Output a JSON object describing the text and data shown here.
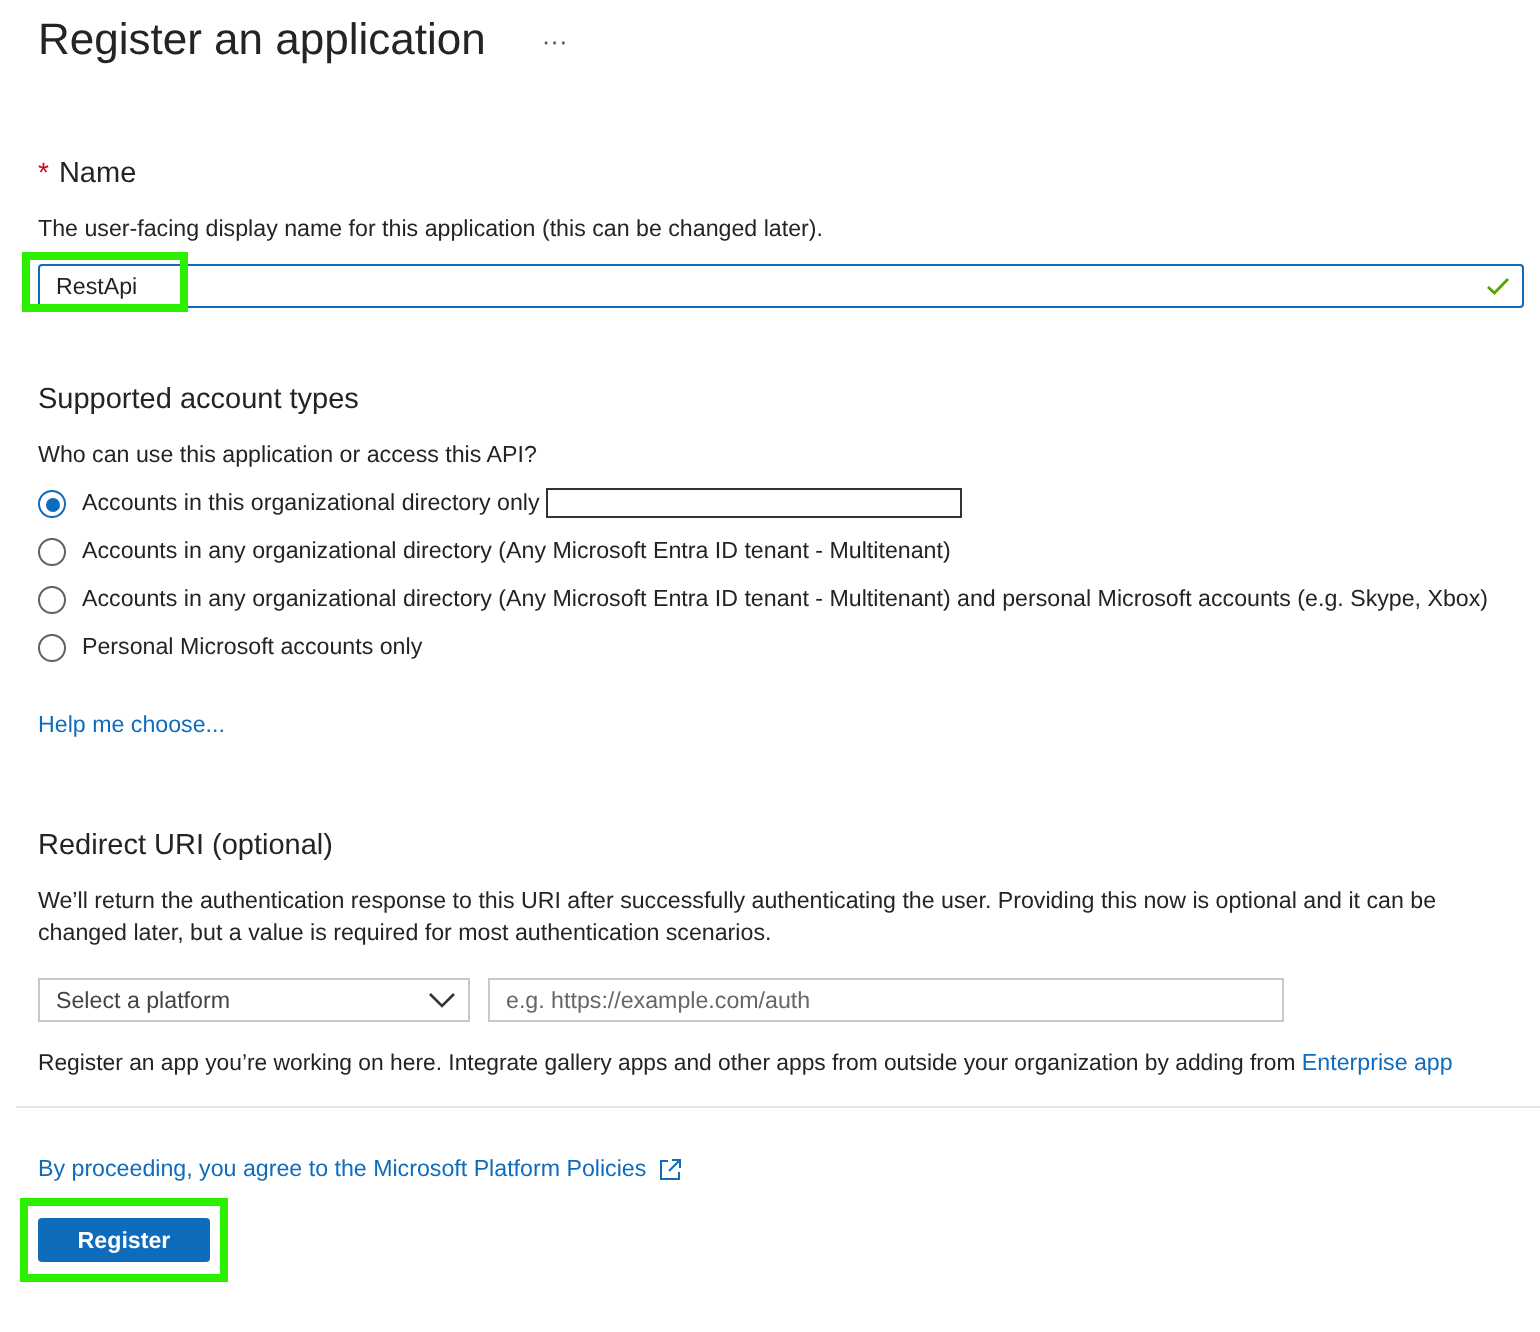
{
  "page": {
    "title": "Register an application",
    "more": "···"
  },
  "name_section": {
    "required_mark": "*",
    "label": "Name",
    "description": "The user-facing display name for this application (this can be changed later).",
    "field": {
      "value": "RestApi",
      "valid": true
    }
  },
  "account_types": {
    "heading": "Supported account types",
    "question": "Who can use this application or access this API?",
    "options": [
      {
        "label": "Accounts in this organizational directory only",
        "selected": true,
        "redacted": true
      },
      {
        "label": "Accounts in any organizational directory (Any Microsoft Entra ID tenant - Multitenant)",
        "selected": false,
        "redacted": false
      },
      {
        "label": "Accounts in any organizational directory (Any Microsoft Entra ID tenant - Multitenant) and personal Microsoft accounts (e.g. Skype, Xbox)",
        "selected": false,
        "redacted": false
      },
      {
        "label": "Personal Microsoft accounts only",
        "selected": false,
        "redacted": false
      }
    ]
  },
  "help_link": "Help me choose...",
  "redirect": {
    "heading": "Redirect URI (optional)",
    "description": "We’ll return the authentication response to this URI after successfully authenticating the user. Providing this now is optional and it can be changed later, but a value is required for most authentication scenarios.",
    "platform": {
      "placeholder": "Select a platform"
    },
    "uri": {
      "placeholder": "e.g. https://example.com/auth"
    },
    "note": "Register an app you’re working on here. Integrate gallery apps and other apps from outside your organization by adding from ",
    "note_link": "Enterprise app"
  },
  "policies_link": "By proceeding, you agree to the Microsoft Platform Policies",
  "register_button": "Register"
}
